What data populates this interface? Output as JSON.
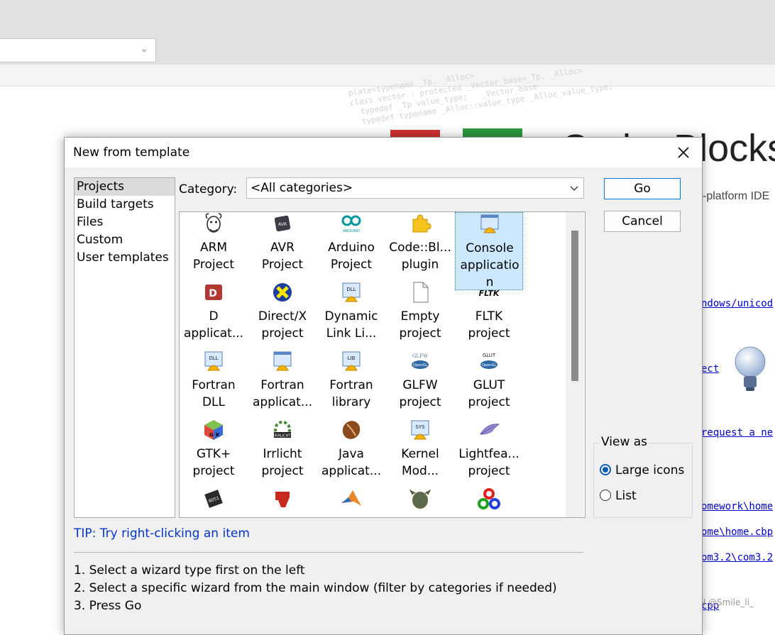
{
  "background": {
    "top_combo": {
      "value": ""
    },
    "code_watermark": "plate<typename _Tp, _Alloc>\nclass vector : protected _Vector_base<_Tp, _Alloc>\n  typedef _Tp value_type;   _Vector_base\n  typedef typename _Alloc::value_type _Alloc_value_type;",
    "logo_text": "Code::Blocks",
    "subtitle": "-platform IDE",
    "links": [
      "ndows/unicod",
      "ect",
      "request a ne",
      "omework\\home",
      "ome\\home.cbp",
      "om3.2\\com3.2",
      "cpp"
    ]
  },
  "dialog": {
    "title": "New from template",
    "left_list": [
      "Projects",
      "Build targets",
      "Files",
      "Custom",
      "User templates"
    ],
    "selected_left": "Projects",
    "category_label": "Category:",
    "category_value": "<All categories>",
    "items": [
      [
        "ARM",
        "Project"
      ],
      [
        "AVR",
        "Project"
      ],
      [
        "Arduino",
        "Project"
      ],
      [
        "Code::Bl...",
        "plugin"
      ],
      [
        "Console",
        "applicatio",
        "n"
      ],
      [
        "D",
        "applicat..."
      ],
      [
        "Direct/X",
        "project"
      ],
      [
        "Dynamic",
        "Link Li..."
      ],
      [
        "Empty",
        "project"
      ],
      [
        "FLTK",
        "project"
      ],
      [
        "Fortran",
        "DLL"
      ],
      [
        "Fortran",
        "applicat..."
      ],
      [
        "Fortran",
        "library"
      ],
      [
        "GLFW",
        "project"
      ],
      [
        "GLUT",
        "project"
      ],
      [
        "GTK+",
        "project"
      ],
      [
        "Irrlicht",
        "project"
      ],
      [
        "Java",
        "applicat..."
      ],
      [
        "Kernel",
        "Mod..."
      ],
      [
        "Lightfea...",
        "project"
      ],
      [],
      [],
      [],
      [],
      []
    ],
    "icon_names": [
      "gnu-icon",
      "avr-chip-icon",
      "arduino-icon",
      "puzzle-piece-icon",
      "console-app-icon",
      "d-language-icon",
      "directx-icon",
      "dll-icon",
      "empty-file-icon",
      "fltk-icon",
      "fortran-dll-icon",
      "fortran-app-icon",
      "fortran-lib-icon",
      "glfw-icon",
      "glut-icon",
      "gtk-icon",
      "irrlicht-icon",
      "java-bean-icon",
      "kernel-module-icon",
      "feather-icon",
      "chip-8051-icon",
      "ti-logo-icon",
      "matlab-icon",
      "ogre-icon",
      "opencv-icon"
    ],
    "selected_item": 4,
    "icon_text": {
      "avr": "AVR",
      "arduino": "ARDUINO",
      "dll": "DLL",
      "fltk": "FLTK",
      "lib": "LIB",
      "glfw": "GLFW",
      "glut": "GLUT",
      "opengl": "OpenGL",
      "sys": "SYS",
      "irr": "IRRLICHT",
      "chip": "8051"
    },
    "buttons": {
      "go": "Go",
      "cancel": "Cancel"
    },
    "view_as": {
      "legend": "View as",
      "options": [
        "Large icons",
        "List"
      ],
      "selected": "Large icons"
    },
    "tip": "TIP: Try right-clicking an item",
    "instructions": [
      "1. Select a wizard type first on the left",
      "2. Select a specific wizard from the main window (filter by categories if needed)",
      "3. Press Go"
    ]
  },
  "watermark": "CSDN @Smile_li_",
  "colors": {
    "selection": "#cce8ff",
    "tip": "#0033cc",
    "go_border": "#0078d7",
    "radio": "#0f5cb6"
  }
}
